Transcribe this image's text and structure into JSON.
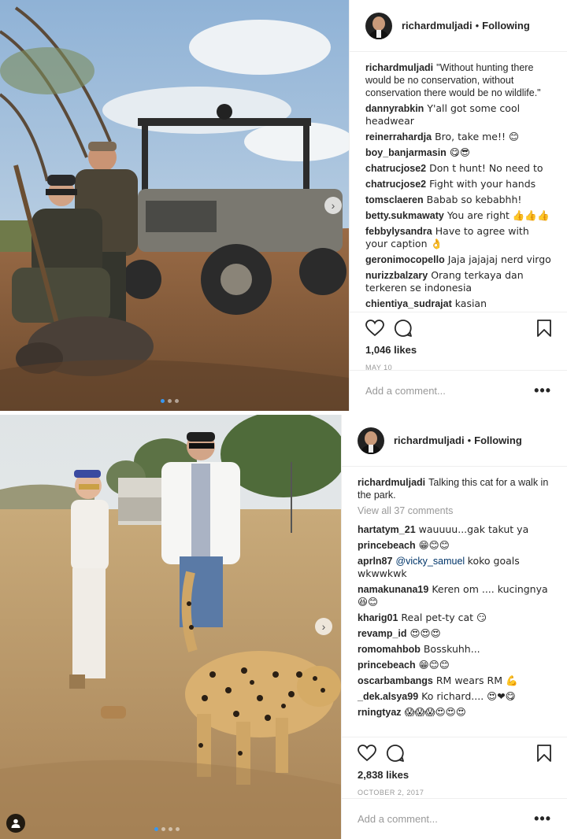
{
  "posts": [
    {
      "username": "richardmuljadi",
      "follow_status": "Following",
      "caption_user": "richardmuljadi",
      "caption_text": "\"Without hunting there would be no conservation, without conservation there would be no wildlife.\"",
      "view_all": "",
      "comments": [
        {
          "user": "dannyrabkin",
          "text": "Y'all got some cool headwear"
        },
        {
          "user": "reinerrahardja",
          "text": "Bro, take me!! 😊"
        },
        {
          "user": "boy_banjarmasin",
          "text": "😋😎"
        },
        {
          "user": "chatrucjose2",
          "text": "Don t hunt! No need to"
        },
        {
          "user": "chatrucjose2",
          "text": "Fight with your hands"
        },
        {
          "user": "tomsclaeren",
          "text": "Babab so kebabhh!"
        },
        {
          "user": "betty.sukmawaty",
          "text": "You are right 👍👍👍"
        },
        {
          "user": "febbylysandra",
          "text": "Have to agree with your caption 👌"
        },
        {
          "user": "geronimocopello",
          "text": "Jaja jajajaj nerd virgo"
        },
        {
          "user": "nurizzbalzary",
          "text": "Orang terkaya dan terkeren se indonesia"
        },
        {
          "user": "chientiya_sudrajat",
          "text": "kasian"
        }
      ],
      "likes": "1,046 likes",
      "date": "MAY 10",
      "add_comment_placeholder": "Add a comment...",
      "more_label": "•••"
    },
    {
      "username": "richardmuljadi",
      "follow_status": "Following",
      "caption_user": "richardmuljadi",
      "caption_text": "Talking this cat for a walk in the park.",
      "view_all": "View all 37 comments",
      "comments": [
        {
          "user": "hartatym_21",
          "text": "wauuuu...gak takut ya"
        },
        {
          "user": "princebeach",
          "text": "😁😊😊"
        },
        {
          "user": "aprln87",
          "mention": "@vicky_samuel",
          "text": "koko goals wkwwkwk"
        },
        {
          "user": "namakunana19",
          "text": "Keren om .... kucingnya 😆😊"
        },
        {
          "user": "kharig01",
          "text": "Real pet-ty cat 😏"
        },
        {
          "user": "revamp_id",
          "text": "😍😍😍"
        },
        {
          "user": "romomahbob",
          "text": "Bosskuhh..."
        },
        {
          "user": "princebeach",
          "text": "😁😊😊"
        },
        {
          "user": "oscarbambangs",
          "text": "RM wears RM 💪"
        },
        {
          "user": "_dek.alsya99",
          "text": "Ko richard.... 😍❤😋"
        },
        {
          "user": "rningtyaz",
          "text": "😱😱😱😍😍😍"
        }
      ],
      "likes": "2,838 likes",
      "date": "OCTOBER 2, 2017",
      "add_comment_placeholder": "Add a comment...",
      "more_label": "•••"
    }
  ],
  "nav_arrow": "›",
  "colors": {
    "text": "#262626",
    "muted": "#999999",
    "border": "#efefef",
    "link": "#003569",
    "dot_active": "#3897f0"
  }
}
